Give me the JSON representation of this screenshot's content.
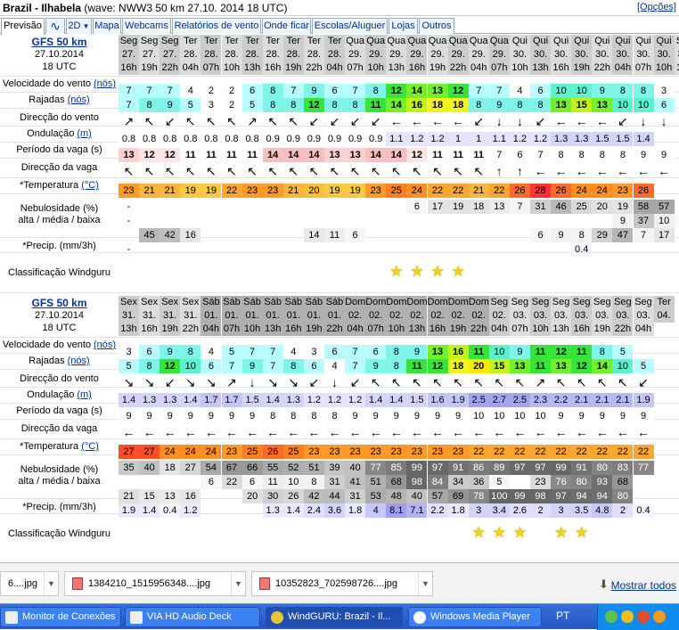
{
  "window": {
    "title_bold": "Brazil - Ilhabela",
    "title_rest": "(wave: NWW3 50 km 27.10. 2014 18 UTC)",
    "options_link": "[Opções]"
  },
  "tabs": [
    {
      "label": "Previsão",
      "active": true
    },
    {
      "label": "",
      "icon": "wave-graph-icon"
    },
    {
      "label": "2D",
      "icon": "chevron-down-icon"
    },
    {
      "label": "Mapa"
    },
    {
      "label": "Webcams"
    },
    {
      "label": "Relatórios de vento"
    },
    {
      "label": "Onde ficar"
    },
    {
      "label": "Escolas/Aluguer"
    },
    {
      "label": "Lojas"
    },
    {
      "label": "Outros"
    }
  ],
  "colors": {
    "link": "#003399",
    "star": "#f3d300",
    "taskbar": "#2456c4"
  },
  "labels": {
    "speed": "Velocidade do vento",
    "speed_unit": "(nós)",
    "gust": "Rajadas",
    "gust_unit": "(nós)",
    "winddir": "Direcção do vento",
    "wave": "Ondulação",
    "wave_unit": "(m)",
    "period": "Período da vaga (s)",
    "wavedir": "Direcção da vaga",
    "temp": "*Temperatura",
    "temp_unit": "(°C)",
    "cloud1": "Nebulosidade (%)",
    "cloud2": "alta / média / baixa",
    "precip": "*Precip. (mm/3h)",
    "rating": "Classificação Windguru"
  },
  "blocks": [
    {
      "model": "GFS 50 km",
      "date": "27.10.2014",
      "utc": "18 UTC",
      "days": [
        "Seg",
        "Seg",
        "Seg",
        "Ter",
        "Ter",
        "Ter",
        "Ter",
        "Ter",
        "Ter",
        "Ter",
        "Ter",
        "Qua",
        "Qua",
        "Qua",
        "Qua",
        "Qua",
        "Qua",
        "Qua",
        "Qua",
        "Qui",
        "Qui",
        "Qui",
        "Qui",
        "Qui",
        "Qui",
        "Qui",
        "Qui",
        "Sex",
        "Sex",
        "Sex"
      ],
      "dates": [
        "27.",
        "27.",
        "27.",
        "28.",
        "28.",
        "28.",
        "28.",
        "28.",
        "28.",
        "28.",
        "28.",
        "29.",
        "29.",
        "29.",
        "29.",
        "29.",
        "29.",
        "29.",
        "29.",
        "30.",
        "30.",
        "30.",
        "30.",
        "30.",
        "30.",
        "30.",
        "30.",
        "31.",
        "31.",
        "31."
      ],
      "hours": [
        "16h",
        "19h",
        "22h",
        "04h",
        "07h",
        "10h",
        "13h",
        "16h",
        "19h",
        "22h",
        "04h",
        "07h",
        "10h",
        "13h",
        "16h",
        "19h",
        "22h",
        "04h",
        "07h",
        "10h",
        "13h",
        "16h",
        "19h",
        "22h",
        "04h",
        "07h",
        "10h",
        "13h",
        "16h",
        "19h"
      ],
      "speed": [
        7,
        7,
        7,
        4,
        2,
        2,
        6,
        8,
        7,
        9,
        6,
        7,
        8,
        12,
        14,
        13,
        12,
        7,
        7,
        4,
        6,
        10,
        10,
        9,
        8,
        8,
        3,
        "",
        "",
        ""
      ],
      "gust": [
        7,
        8,
        9,
        5,
        3,
        2,
        5,
        8,
        8,
        12,
        8,
        8,
        11,
        14,
        16,
        18,
        18,
        8,
        9,
        8,
        8,
        13,
        15,
        13,
        10,
        10,
        6,
        "",
        "",
        ""
      ],
      "winddir": [
        "↗",
        "↖",
        "↙",
        "↖",
        "↖",
        "↖",
        "↗",
        "↖",
        "↖",
        "↙",
        "↙",
        "↙",
        "↙",
        "←",
        "←",
        "←",
        "←",
        "↙",
        "↓",
        "↓",
        "↙",
        "←",
        "←",
        "←",
        "↙",
        "↓",
        "↓",
        "",
        "",
        ""
      ],
      "wave": [
        "0.8",
        "0.8",
        "0.8",
        "0.8",
        "0.8",
        "0.8",
        "0.8",
        "0.9",
        "0.9",
        "0.9",
        "0.9",
        "0.9",
        "0.9",
        "1.1",
        "1.2",
        "1.2",
        "1",
        "1",
        "1.1",
        "1.2",
        "1.2",
        "1.3",
        "1.3",
        "1.5",
        "1.5",
        "1.4",
        "",
        "",
        "",
        ""
      ],
      "period": [
        13,
        12,
        12,
        11,
        11,
        11,
        11,
        14,
        14,
        14,
        13,
        13,
        14,
        14,
        12,
        11,
        11,
        11,
        7,
        6,
        7,
        8,
        8,
        8,
        8,
        9,
        9,
        "",
        "",
        ""
      ],
      "wavedir": [
        "↖",
        "↖",
        "↖",
        "↖",
        "↖",
        "↖",
        "↖",
        "↖",
        "↖",
        "↖",
        "↖",
        "↖",
        "↖",
        "↖",
        "↖",
        "↖",
        "↖",
        "↖",
        "↑",
        "↑",
        "←",
        "←",
        "←",
        "←",
        "←",
        "←",
        "←",
        "",
        "",
        ""
      ],
      "temp": [
        23,
        21,
        21,
        19,
        19,
        22,
        23,
        23,
        21,
        20,
        19,
        19,
        23,
        25,
        24,
        22,
        22,
        21,
        22,
        26,
        28,
        26,
        24,
        24,
        23,
        26,
        "",
        "",
        "",
        ""
      ],
      "cloud_high": [
        "-",
        "",
        "",
        "",
        "",
        "",
        "",
        "",
        "",
        "",
        "",
        "",
        "",
        "",
        "6",
        "17",
        "19",
        "18",
        "13",
        "7",
        "31",
        "46",
        "25",
        "20",
        "19",
        "58",
        "57",
        "",
        "",
        ""
      ],
      "cloud_mid": [
        "-",
        "",
        "",
        "",
        "",
        "",
        "",
        "",
        "",
        "",
        "",
        "",
        "",
        "",
        "",
        "",
        "",
        "",
        "",
        "",
        "",
        "",
        "",
        "",
        "9",
        "37",
        "10",
        "5",
        "",
        ""
      ],
      "cloud_low": [
        "",
        "45",
        "42",
        "16",
        "",
        "",
        "",
        "",
        "",
        "14",
        "11",
        "6",
        "",
        "",
        "",
        "",
        "",
        "",
        "",
        "",
        "6",
        "9",
        "8",
        "29",
        "47",
        "7",
        "17",
        "",
        "",
        ""
      ],
      "precip": [
        "-",
        "",
        "",
        "",
        "",
        "",
        "",
        "",
        "",
        "",
        "",
        "",
        "",
        "",
        "",
        "",
        "",
        "",
        "",
        "",
        "",
        "",
        "0.4",
        "",
        "",
        "",
        "",
        "",
        "",
        ""
      ],
      "stars": [
        13,
        14,
        15,
        16
      ]
    },
    {
      "model": "GFS 50 km",
      "date": "27.10.2014",
      "utc": "18 UTC",
      "days": [
        "Sex",
        "Sex",
        "Sex",
        "Sex",
        "Sáb",
        "Sáb",
        "Sáb",
        "Sáb",
        "Sáb",
        "Sáb",
        "Sáb",
        "Dom",
        "Dom",
        "Dom",
        "Dom",
        "Dom",
        "Dom",
        "Dom",
        "Seg",
        "Seg",
        "Seg",
        "Seg",
        "Seg",
        "Seg",
        "Seg",
        "Seg",
        "Ter",
        "",
        "",
        ""
      ],
      "dates": [
        "31.",
        "31.",
        "31.",
        "31.",
        "01.",
        "01.",
        "01.",
        "01.",
        "01.",
        "01.",
        "01.",
        "02.",
        "02.",
        "02.",
        "02.",
        "02.",
        "02.",
        "02.",
        "02.",
        "03.",
        "03.",
        "03.",
        "03.",
        "03.",
        "03.",
        "03.",
        "04.",
        "",
        "",
        ""
      ],
      "hours": [
        "13h",
        "16h",
        "19h",
        "22h",
        "04h",
        "07h",
        "10h",
        "13h",
        "16h",
        "19h",
        "22h",
        "04h",
        "07h",
        "10h",
        "13h",
        "16h",
        "19h",
        "22h",
        "04h",
        "07h",
        "10h",
        "13h",
        "16h",
        "19h",
        "22h",
        "04h",
        "",
        "",
        "",
        ""
      ],
      "speed": [
        3,
        6,
        9,
        8,
        4,
        5,
        7,
        7,
        4,
        3,
        6,
        7,
        6,
        8,
        9,
        13,
        16,
        11,
        10,
        9,
        11,
        12,
        11,
        8,
        5,
        "",
        "",
        "",
        "",
        ""
      ],
      "gust": [
        5,
        8,
        12,
        10,
        6,
        7,
        9,
        7,
        8,
        6,
        4,
        7,
        9,
        8,
        11,
        12,
        18,
        20,
        15,
        13,
        11,
        13,
        12,
        14,
        10,
        5,
        "",
        "",
        "",
        ""
      ],
      "winddir": [
        "↘",
        "↘",
        "↙",
        "↘",
        "↘",
        "↗",
        "↓",
        "↘",
        "↘",
        "↙",
        "↓",
        "↙",
        "↖",
        "↖",
        "↖",
        "↖",
        "↖",
        "↖",
        "↖",
        "↖",
        "↗",
        "↖",
        "↖",
        "↖",
        "↖",
        "↙",
        "",
        "",
        "",
        ""
      ],
      "wave": [
        "1.4",
        "1.3",
        "1.3",
        "1.4",
        "1.7",
        "1.7",
        "1.5",
        "1.4",
        "1.3",
        "1.2",
        "1.2",
        "1.2",
        "1.4",
        "1.4",
        "1.5",
        "1.6",
        "1.9",
        "2.5",
        "2.7",
        "2.5",
        "2.3",
        "2.2",
        "2.1",
        "2.1",
        "2.1",
        "1.9",
        "",
        "",
        "",
        ""
      ],
      "period": [
        9,
        9,
        9,
        9,
        9,
        9,
        9,
        8,
        8,
        8,
        8,
        9,
        9,
        9,
        9,
        9,
        9,
        10,
        10,
        10,
        10,
        9,
        9,
        9,
        9,
        9,
        "",
        "",
        "",
        ""
      ],
      "wavedir": [
        "←",
        "←",
        "←",
        "←",
        "←",
        "←",
        "←",
        "←",
        "←",
        "←",
        "←",
        "←",
        "←",
        "←",
        "←",
        "←",
        "←",
        "←",
        "←",
        "←",
        "←",
        "←",
        "←",
        "←",
        "←",
        "←",
        "",
        "",
        "",
        ""
      ],
      "temp": [
        27,
        27,
        24,
        24,
        24,
        23,
        25,
        26,
        25,
        23,
        23,
        23,
        23,
        23,
        23,
        23,
        23,
        22,
        22,
        22,
        22,
        22,
        22,
        22,
        22,
        22,
        "",
        "",
        "",
        ""
      ],
      "cloud_high": [
        "35",
        "40",
        "18",
        "27",
        "54",
        "67",
        "66",
        "55",
        "52",
        "51",
        "39",
        "40",
        "77",
        "85",
        "99",
        "97",
        "91",
        "86",
        "89",
        "97",
        "97",
        "99",
        "91",
        "80",
        "83",
        "77",
        "",
        "",
        "",
        ""
      ],
      "cloud_mid": [
        "",
        "",
        "",
        "",
        "6",
        "22",
        "6",
        "11",
        "10",
        "8",
        "31",
        "41",
        "51",
        "68",
        "98",
        "84",
        "34",
        "36",
        "5",
        "",
        "23",
        "76",
        "80",
        "93",
        "68",
        "",
        "",
        "",
        "",
        ""
      ],
      "cloud_low": [
        "21",
        "15",
        "13",
        "16",
        "",
        "",
        "20",
        "30",
        "26",
        "42",
        "44",
        "31",
        "53",
        "48",
        "40",
        "57",
        "69",
        "78",
        "100",
        "99",
        "98",
        "97",
        "94",
        "94",
        "80",
        "",
        "",
        "",
        "",
        ""
      ],
      "precip": [
        "1.9",
        "1.4",
        "0.4",
        "1.2",
        "",
        "",
        "",
        "1.3",
        "1.4",
        "2.4",
        "3.6",
        "1.8",
        "4",
        "8.1",
        "7.1",
        "2.2",
        "1.8",
        "3",
        "3.4",
        "2.6",
        "2",
        "3",
        "3.5",
        "4.8",
        "2",
        "0.4",
        "",
        "",
        "",
        ""
      ],
      "stars": [
        17,
        18,
        19,
        21,
        22
      ]
    }
  ],
  "downloads": {
    "items": [
      "6....jpg",
      "1384210_1515956348....jpg",
      "10352823_702598726....jpg"
    ],
    "show_all": "Mostrar todos"
  },
  "taskbar": {
    "items": [
      "Monitor de Conexões",
      "VIA HD Audio Deck",
      "WindGURU: Brazil - Il...",
      "Windows Media Player"
    ],
    "lang": "PT"
  }
}
